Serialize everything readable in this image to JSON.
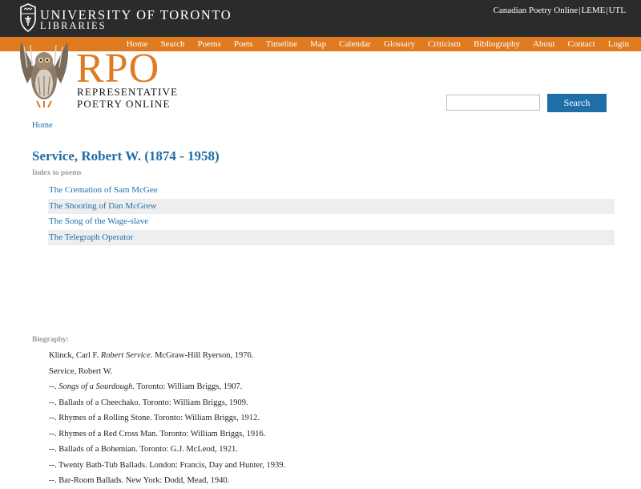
{
  "header": {
    "institution_line1": "UNIVERSITY OF TORONTO",
    "institution_line2": "LIBRARIES",
    "top_links": [
      "Canadian Poetry Online",
      "LEME",
      "UTL"
    ],
    "top_link_separator": "|",
    "crest_icon": "university-crest-icon"
  },
  "nav": {
    "items": [
      "Home",
      "Search",
      "Poems",
      "Poets",
      "Timeline",
      "Map",
      "Calendar",
      "Glossary",
      "Criticism",
      "Bibliography",
      "About",
      "Contact",
      "Login"
    ]
  },
  "logo": {
    "icon": "owl-logo-icon",
    "title": "RPO",
    "subtitle_line1": "REPRESENTATIVE",
    "subtitle_line2": "POETRY ONLINE"
  },
  "search": {
    "value": "",
    "button_label": "Search"
  },
  "breadcrumb": "Home",
  "poet": {
    "title": "Service, Robert W. (1874 - 1958)"
  },
  "poems_section": {
    "label": "Index to poems",
    "items": [
      "The Cremation of Sam McGee",
      "The Shooting of Dan McGrew",
      "The Song of the Wage-slave",
      "The Telegraph Operator"
    ]
  },
  "biography_section": {
    "label": "Biography:",
    "items": [
      {
        "prefix": "Klinck, Carl F. ",
        "title": "Robert Service",
        "suffix": ". McGraw-Hill Ryerson, 1976."
      },
      {
        "prefix": "Service, Robert W.",
        "title": "",
        "suffix": ""
      },
      {
        "prefix": "--. ",
        "title": "Songs of a Sourdough",
        "suffix": ". Toronto: William Briggs, 1907."
      },
      {
        "prefix": "--. Ballads of a Cheechako. Toronto: William Briggs, 1909.",
        "title": "",
        "suffix": ""
      },
      {
        "prefix": "--. Rhymes of a Rolling Stone. Toronto: William Briggs, 1912.",
        "title": "",
        "suffix": ""
      },
      {
        "prefix": "--. Rhymes of a Red Cross Man. Toronto: William Briggs, 1916.",
        "title": "",
        "suffix": ""
      },
      {
        "prefix": "--. Ballads of a Bohemian. Toronto: G.J. McLeod, 1921.",
        "title": "",
        "suffix": ""
      },
      {
        "prefix": "--. Twenty Bath-Tub Ballads. London: Francis, Day and Hunter, 1939.",
        "title": "",
        "suffix": ""
      },
      {
        "prefix": "--. Bar-Room Ballads. New York: Dodd, Mead, 1940.",
        "title": "",
        "suffix": ""
      }
    ]
  },
  "colors": {
    "header_bg": "#2b2b2b",
    "nav_bg": "#e07a1f",
    "link": "#1f6ea8",
    "button": "#1f6ea8",
    "alt_row": "#eeeeee"
  }
}
